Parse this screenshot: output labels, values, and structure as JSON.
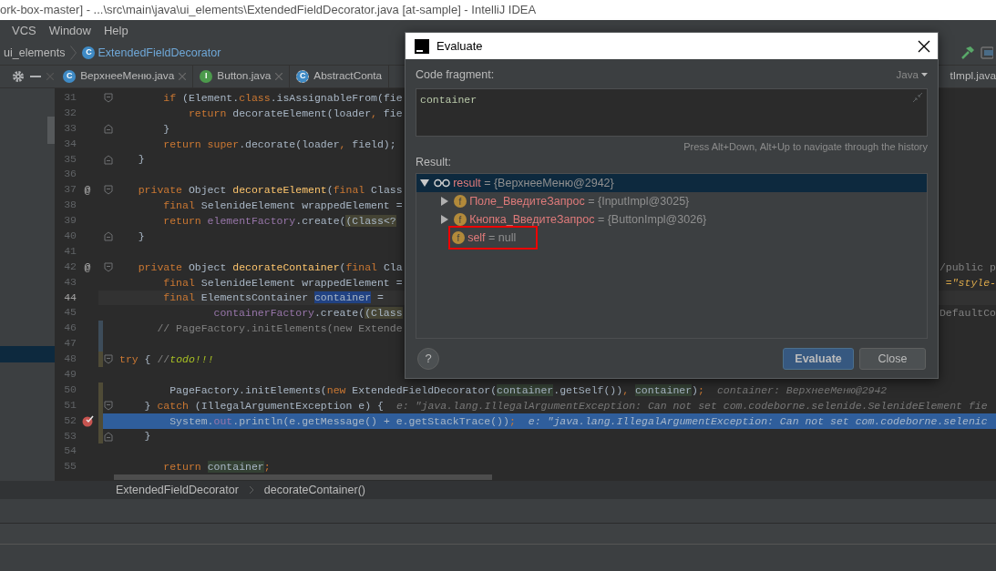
{
  "window": {
    "title": "ork-box-master] - ...\\src\\main\\java\\ui_elements\\ExtendedFieldDecorator.java [at-sample] - IntelliJ IDEA"
  },
  "menu": [
    {
      "label": "VCS"
    },
    {
      "label": "Window"
    },
    {
      "label": "Help"
    }
  ],
  "breadcrumbs": [
    {
      "label": "ui_elements",
      "kind": "package"
    },
    {
      "label": "ExtendedFieldDecorator",
      "kind": "class",
      "icon": "C"
    }
  ],
  "tabs": [
    {
      "label": "ВерхнееМеню.java",
      "kind": "class",
      "icon": "C",
      "selected": false
    },
    {
      "label": "Button.java",
      "kind": "interface",
      "icon": "I",
      "selected": false
    },
    {
      "label": "AbstractConta",
      "kind": "abstract",
      "icon": "C",
      "selected": false
    },
    {
      "label": "tImpl.java",
      "kind": "plain",
      "selected": false
    }
  ],
  "editor": {
    "lines": [
      {
        "number": "31",
        "kind": "opening",
        "selected": false,
        "current": false,
        "breakpoint": false,
        "segments": [
          {
            "text": "       if",
            "kind": "keyword"
          },
          {
            "text": " (Element.",
            "kind": "plain"
          },
          {
            "text": "class",
            "kind": "keyword"
          },
          {
            "text": ".isAssignableFrom(fie",
            "kind": "plain"
          }
        ]
      },
      {
        "number": "32",
        "kind": "plain",
        "selected": false,
        "current": false,
        "breakpoint": false,
        "segments": [
          {
            "text": "           return",
            "kind": "keyword"
          },
          {
            "text": " decorateElement(loader",
            "kind": "plain"
          },
          {
            "text": ",",
            "kind": "keyword"
          },
          {
            "text": " fie",
            "kind": "plain"
          }
        ]
      },
      {
        "number": "33",
        "kind": "closing",
        "selected": false,
        "current": false,
        "breakpoint": false,
        "segments": [
          {
            "text": "       }",
            "kind": "plain"
          }
        ]
      },
      {
        "number": "34",
        "kind": "plain",
        "selected": false,
        "current": false,
        "breakpoint": false,
        "segments": [
          {
            "text": "       return super",
            "kind": "keyword"
          },
          {
            "text": ".decorate(loader",
            "kind": "plain"
          },
          {
            "text": ",",
            "kind": "keyword"
          },
          {
            "text": " field);",
            "kind": "plain"
          }
        ]
      },
      {
        "number": "35",
        "kind": "closing",
        "selected": false,
        "current": false,
        "breakpoint": false,
        "segments": [
          {
            "text": "   }",
            "kind": "plain"
          }
        ]
      },
      {
        "number": "36",
        "kind": "plain",
        "selected": false,
        "current": false,
        "breakpoint": false
      },
      {
        "number": "37",
        "annotation": "@",
        "kind": "opening",
        "selected": false,
        "current": false,
        "breakpoint": false,
        "segments": [
          {
            "text": "   private",
            "kind": "keyword"
          },
          {
            "text": " Object ",
            "kind": "plain"
          },
          {
            "text": "decorateElement",
            "kind": "method"
          },
          {
            "text": "(",
            "kind": "plain"
          },
          {
            "text": "final",
            "kind": "keyword"
          },
          {
            "text": " Class",
            "kind": "plain"
          }
        ]
      },
      {
        "number": "38",
        "kind": "plain",
        "selected": false,
        "current": false,
        "breakpoint": false,
        "segments": [
          {
            "text": "       final",
            "kind": "keyword"
          },
          {
            "text": " SelenideElement wrappedElement =",
            "kind": "plain"
          }
        ]
      },
      {
        "number": "39",
        "kind": "plain",
        "selected": false,
        "current": false,
        "breakpoint": false,
        "segments": [
          {
            "text": "       return",
            "kind": "keyword"
          },
          {
            "text": " elementFactory",
            "kind": "field"
          },
          {
            "text": ".create(",
            "kind": "plain"
          },
          {
            "text": "(Class<?",
            "kind": "cast"
          }
        ]
      },
      {
        "number": "40",
        "kind": "closing",
        "selected": false,
        "current": false,
        "breakpoint": false,
        "segments": [
          {
            "text": "   }",
            "kind": "plain"
          }
        ]
      },
      {
        "number": "41",
        "kind": "plain",
        "selected": false,
        "current": false,
        "breakpoint": false
      },
      {
        "number": "42",
        "annotation": "@",
        "kind": "opening",
        "selected": false,
        "current": false,
        "breakpoint": false,
        "segments": [
          {
            "text": "   private",
            "kind": "keyword"
          },
          {
            "text": " Object ",
            "kind": "plain"
          },
          {
            "text": "decorateContainer",
            "kind": "method"
          },
          {
            "text": "(",
            "kind": "plain"
          },
          {
            "text": "final",
            "kind": "keyword"
          },
          {
            "text": " Cla",
            "kind": "plain"
          }
        ],
        "tail": {
          "text": "/public p",
          "kind": "comment"
        }
      },
      {
        "number": "43",
        "kind": "plain",
        "selected": false,
        "current": false,
        "breakpoint": false,
        "segments": [
          {
            "text": "       final",
            "kind": "keyword"
          },
          {
            "text": " SelenideElement wrappedElement =",
            "kind": "plain"
          }
        ],
        "tail": {
          "text": "=\"style-",
          "kind": "string"
        }
      },
      {
        "number": "44",
        "kind": "plain",
        "selected": false,
        "current": true,
        "breakpoint": false,
        "segments": [
          {
            "text": "       final",
            "kind": "keyword"
          },
          {
            "text": " ElementsContainer ",
            "kind": "plain"
          },
          {
            "text": "container",
            "kind": "selection"
          },
          {
            "text": " =",
            "kind": "plain"
          }
        ]
      },
      {
        "number": "45",
        "kind": "plain",
        "selected": false,
        "current": false,
        "breakpoint": false,
        "segments": [
          {
            "text": "               containerFactory",
            "kind": "field"
          },
          {
            "text": ".create(",
            "kind": "plain"
          },
          {
            "text": "(Class",
            "kind": "cast"
          }
        ],
        "tail": {
          "text": "DefaultCo",
          "kind": "comment"
        }
      },
      {
        "number": "46",
        "color": "#3d4c5a",
        "kind": "plain",
        "selected": false,
        "current": false,
        "breakpoint": false,
        "segments": [
          {
            "text": "      // PageFactory.initElements(new Extende",
            "kind": "comment"
          }
        ]
      },
      {
        "number": "47",
        "color": "#3d4c5a",
        "kind": "plain",
        "selected": false,
        "current": false,
        "breakpoint": false
      },
      {
        "number": "48",
        "color": "#4f4b36",
        "kind": "opening",
        "selected": false,
        "current": false,
        "breakpoint": false,
        "segments": [
          {
            "text": "try",
            "kind": "keyword"
          },
          {
            "text": " { ",
            "kind": "plain"
          },
          {
            "text": "//",
            "kind": "comment"
          },
          {
            "text": "todo!!!",
            "kind": "todo"
          }
        ]
      },
      {
        "number": "49",
        "kind": "plain",
        "selected": false,
        "current": false,
        "breakpoint": false
      },
      {
        "number": "50",
        "color": "#4f4b36",
        "kind": "plain",
        "selected": false,
        "current": false,
        "breakpoint": false,
        "segments": [
          {
            "text": "        PageFactory.initElements(",
            "kind": "plain"
          },
          {
            "text": "new",
            "kind": "keyword"
          },
          {
            "text": " ExtendedFieldDecorator(",
            "kind": "plain"
          },
          {
            "text": "container",
            "kind": "usage"
          },
          {
            "text": ".getSelf())",
            "kind": "plain"
          },
          {
            "text": ", ",
            "kind": "keyword"
          },
          {
            "text": "container",
            "kind": "usage"
          },
          {
            "text": ")",
            "kind": "plain"
          },
          {
            "text": ";",
            "kind": "keyword"
          }
        ],
        "hint": "container: ВерхнееМеню@2942"
      },
      {
        "number": "51",
        "color": "#4f4b36",
        "kind": "opening",
        "selected": false,
        "current": false,
        "breakpoint": false,
        "segments": [
          {
            "text": "    } ",
            "kind": "plain"
          },
          {
            "text": "catch",
            "kind": "keyword"
          },
          {
            "text": " (IllegalArgumentException e) {",
            "kind": "plain"
          }
        ],
        "hint": "e: \"java.lang.IllegalArgumentException: Can not set com.codeborne.selenide.SelenideElement fie"
      },
      {
        "number": "52",
        "color": "#4f4b36",
        "kind": "plain",
        "selected": true,
        "current": false,
        "breakpoint": true,
        "segments": [
          {
            "text": "        System.",
            "kind": "plain"
          },
          {
            "text": "out",
            "kind": "field"
          },
          {
            "text": ".println(e.getMessage() + e.getStackTrace())",
            "kind": "plain"
          },
          {
            "text": ";",
            "kind": "keyword"
          }
        ],
        "hint": "e: \"java.lang.IllegalArgumentException: Can not set com.codeborne.selenic"
      },
      {
        "number": "53",
        "color": "#4f4b36",
        "kind": "closing",
        "selected": false,
        "current": false,
        "breakpoint": false,
        "segments": [
          {
            "text": "    }",
            "kind": "plain"
          }
        ]
      },
      {
        "number": "54",
        "kind": "plain",
        "selected": false,
        "current": false,
        "breakpoint": false
      },
      {
        "number": "55",
        "kind": "plain",
        "selected": false,
        "current": false,
        "breakpoint": false,
        "segments": [
          {
            "text": "       return ",
            "kind": "keyword"
          },
          {
            "text": "container",
            "kind": "usage"
          },
          {
            "text": ";",
            "kind": "keyword"
          }
        ]
      }
    ],
    "path": [
      {
        "label": "ExtendedFieldDecorator"
      },
      {
        "label": "decorateContainer()"
      }
    ]
  },
  "evaluate_dialog": {
    "title": "Evaluate",
    "code_label": "Code fragment:",
    "language": "Java",
    "expression": "container",
    "history_hint": "Press Alt+Down, Alt+Up to navigate through the history",
    "result_label": "Result:",
    "tree": [
      {
        "name": "result",
        "value": "= {ВерхнееМеню@2942}",
        "kind": "watch",
        "expandable": true,
        "expanded": true,
        "selected": true,
        "highlighted": false,
        "children": [
          {
            "name": "Поле_ВведитеЗапрос",
            "value": "= {InputImpl@3025}",
            "kind": "field",
            "icon": "f",
            "expandable": true,
            "expanded": false,
            "selected": false,
            "highlighted": false
          },
          {
            "name": "Кнопка_ВведитеЗапрос",
            "value": "= {ButtonImpl@3026}",
            "kind": "field",
            "icon": "f",
            "expandable": true,
            "expanded": false,
            "selected": false,
            "highlighted": false
          },
          {
            "name": "self",
            "value": "= null",
            "kind": "field",
            "icon": "f",
            "expandable": false,
            "expanded": false,
            "selected": false,
            "highlighted": true
          }
        ]
      }
    ],
    "help": "?",
    "buttons": [
      {
        "label": "Evaluate",
        "primary": true
      },
      {
        "label": "Close",
        "primary": false
      }
    ]
  }
}
